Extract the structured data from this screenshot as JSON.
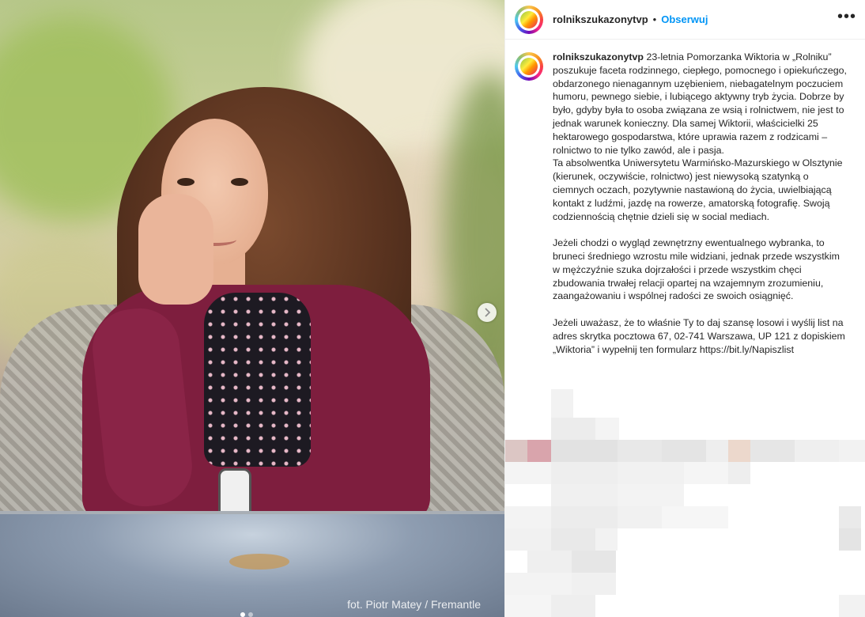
{
  "photo": {
    "credit": "fot. Piotr Matey / Fremantle",
    "next_icon": "chevron-right-icon",
    "carousel_dots": 2,
    "active_dot": 0
  },
  "post": {
    "username": "rolnikszukazonytvp",
    "separator": "•",
    "follow_label": "Obserwuj",
    "more_icon": "more-horizontal-icon",
    "more_label": "•••",
    "avatar_icon": "rolnik-szuka-zony-logo"
  },
  "caption": {
    "username": "rolnikszukazonytvp",
    "paragraph1": "23-letnia Pomorzanka Wiktoria w „Rolniku” poszukuje faceta rodzinnego, ciepłego, pomocnego i opiekuńczego, obdarzonego nienagannym uzębieniem, niebagatelnym poczuciem humoru, pewnego siebie, i lubiącego aktywny tryb życia. Dobrze by było, gdyby była to osoba związana ze wsią i rolnictwem, nie jest to jednak warunek konieczny. Dla samej Wiktorii, właścicielki 25 hektarowego gospodarstwa, które uprawia razem z rodzicami – rolnictwo to nie tylko zawód, ale i pasja.",
    "paragraph2": "Ta absolwentka Uniwersytetu Warmińsko-Mazurskiego w Olsztynie (kierunek, oczywiście, rolnictwo) jest niewysoką szatynką o ciemnych oczach, pozytywnie nastawioną do życia, uwielbiającą kontakt z ludźmi, jazdę na rowerze, amatorską fotografię. Swoją codziennością chętnie dzieli się w social mediach.",
    "paragraph3": "Jeżeli chodzi o wygląd zewnętrzny ewentualnego wybranka, to bruneci średniego wzrostu mile widziani, jednak przede wszystkim w mężczyźnie szuka dojrzałości i przede wszystkim chęci zbudowania trwałej relacji opartej na wzajemnym zrozumieniu, zaangażowaniu i wspólnej radości ze swoich osiągnięć.",
    "paragraph4": "Jeżeli uważasz, że to właśnie Ty to daj szansę losowi i wyślij list na adres skrytka pocztowa 67, 02-741 Warszawa, UP 121 z dopiskiem „Wiktoria” i wypełnij ten formularz https://bit.ly/Napiszlist"
  },
  "colors": {
    "accent": "#0095f6",
    "text": "#262626",
    "border": "#efefef"
  }
}
